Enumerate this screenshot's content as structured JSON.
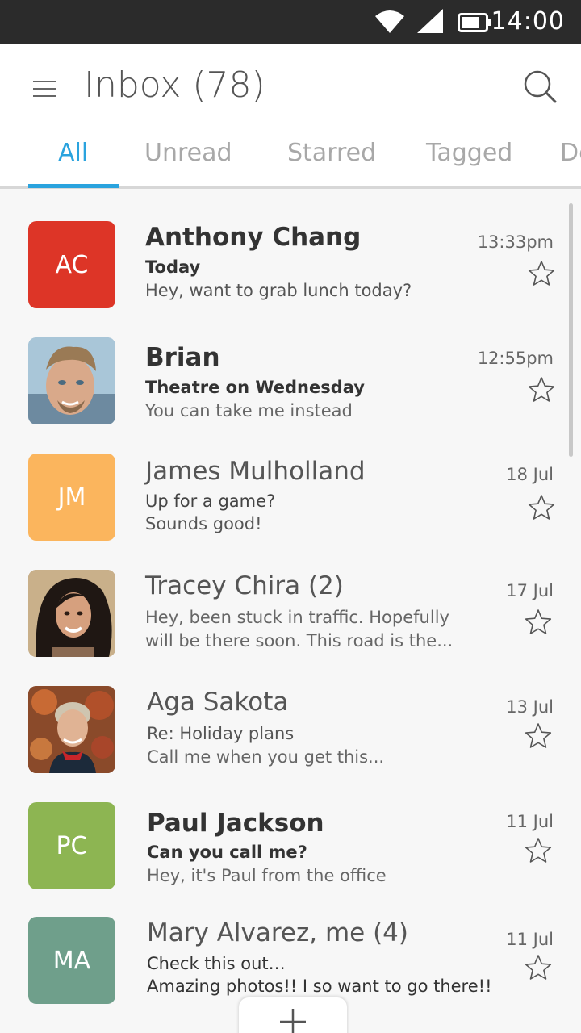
{
  "status_bar": {
    "time": "14:00"
  },
  "header": {
    "title": "Inbox (78)"
  },
  "tabs": [
    {
      "label": "All"
    },
    {
      "label": "Unread"
    },
    {
      "label": "Starred"
    },
    {
      "label": "Tagged"
    },
    {
      "label": "De"
    }
  ],
  "messages": [
    {
      "initials": "AC",
      "avatar_color": "#dd3527",
      "name": "Anthony Chang",
      "subject": "Today",
      "preview": "Hey, want to grab lunch today?",
      "preview2": "",
      "date": "13:33pm",
      "unread": true
    },
    {
      "initials": "",
      "avatar_color": "",
      "name": "Brian",
      "subject": "Theatre on Wednesday",
      "preview": "You can take me instead",
      "preview2": "",
      "date": "12:55pm",
      "unread": true
    },
    {
      "initials": "JM",
      "avatar_color": "#fbb55d",
      "name": "James Mulholland",
      "subject": "Up for a game?",
      "preview": "Sounds good!",
      "preview2": "",
      "date": "18 Jul",
      "unread": false
    },
    {
      "initials": "",
      "avatar_color": "",
      "name": "Tracey Chira (2)",
      "subject": "",
      "preview": "Hey, been stuck in traffic. Hopefully",
      "preview2": "will be there soon. This road is the...",
      "date": "17 Jul",
      "unread": false
    },
    {
      "initials": "",
      "avatar_color": "",
      "name": "Aga Sakota",
      "subject": "Re: Holiday plans",
      "preview": "Call me when you get this...",
      "preview2": "",
      "date": "13 Jul",
      "unread": false
    },
    {
      "initials": "PC",
      "avatar_color": "#8db552",
      "name": "Paul Jackson",
      "subject": "Can you call me?",
      "preview": "Hey, it's Paul from the office",
      "preview2": "",
      "date": "11 Jul",
      "unread": true
    },
    {
      "initials": "MA",
      "avatar_color": "#6f9f8b",
      "name": "Mary Alvarez, me (4)",
      "subject": "Check this out…",
      "preview": "Amazing photos!! I so want to go there!!",
      "preview2": "",
      "date": "11 Jul",
      "unread": false
    }
  ],
  "colors": {
    "accent": "#2aa3de",
    "status_bar": "#2b2b2b"
  },
  "icons": {
    "menu": "hamburger-icon",
    "search": "search-icon",
    "star": "star-outline-icon",
    "compose": "plus-icon"
  }
}
